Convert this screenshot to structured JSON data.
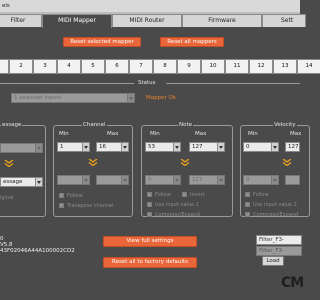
{
  "window": {
    "title": "els"
  },
  "tabs": [
    {
      "label": "Filter"
    },
    {
      "label": "MIDI Mapper"
    },
    {
      "label": "MIDI Router"
    },
    {
      "label": "Firmware"
    },
    {
      "label": "Sett"
    }
  ],
  "mapper_actions": {
    "reset_selected": "Reset selected mapper",
    "reset_all": "Reset all mappers"
  },
  "channels": [
    "2",
    "3",
    "4",
    "5",
    "6",
    "7",
    "8",
    "9",
    "10",
    "11",
    "12",
    "13",
    "14"
  ],
  "status": {
    "heading": "Status",
    "inputs_select": "1 selected inputs",
    "message": "Mapper Ok",
    "message_color": "#e8822c"
  },
  "sections": {
    "message": {
      "label": "essage",
      "out_value": "essage",
      "original_label": "iginal"
    },
    "channel": {
      "label": "Channel",
      "min_label": "Min",
      "max_label": "Max",
      "min_value": "1",
      "max_value": "16",
      "follow_label": "Follow",
      "transpose_label": "Transpose channel"
    },
    "note": {
      "label": "Note",
      "min_label": "Min",
      "max_label": "Max",
      "min_value": "53",
      "max_value": "127",
      "out_min": "0",
      "out_max": "127",
      "follow_label": "Follow",
      "invert_label": "Invert",
      "input_value1_label": "Use input value 1",
      "compress_label": "Compress/Expand"
    },
    "velocity": {
      "label": "Velocity",
      "min_label": "Min",
      "max_label": "Max",
      "min_value": "0",
      "max_value": "127",
      "out_min": "0",
      "follow_label": "Follow",
      "input_value2_label": "Use input value 2",
      "compress_label": "Compress/Expand"
    }
  },
  "device_info": {
    "line1": "0",
    "line2": "V5.8",
    "line3": "43F02046A44A100002CD2"
  },
  "settings_actions": {
    "view_full": "View full settings",
    "factory_reset": "Reset all to factory defaults"
  },
  "preset": {
    "name_value": "Filter_F3-",
    "name_value2": "Filter_F3-",
    "load": "Load"
  },
  "logo": {
    "text": "CM"
  }
}
